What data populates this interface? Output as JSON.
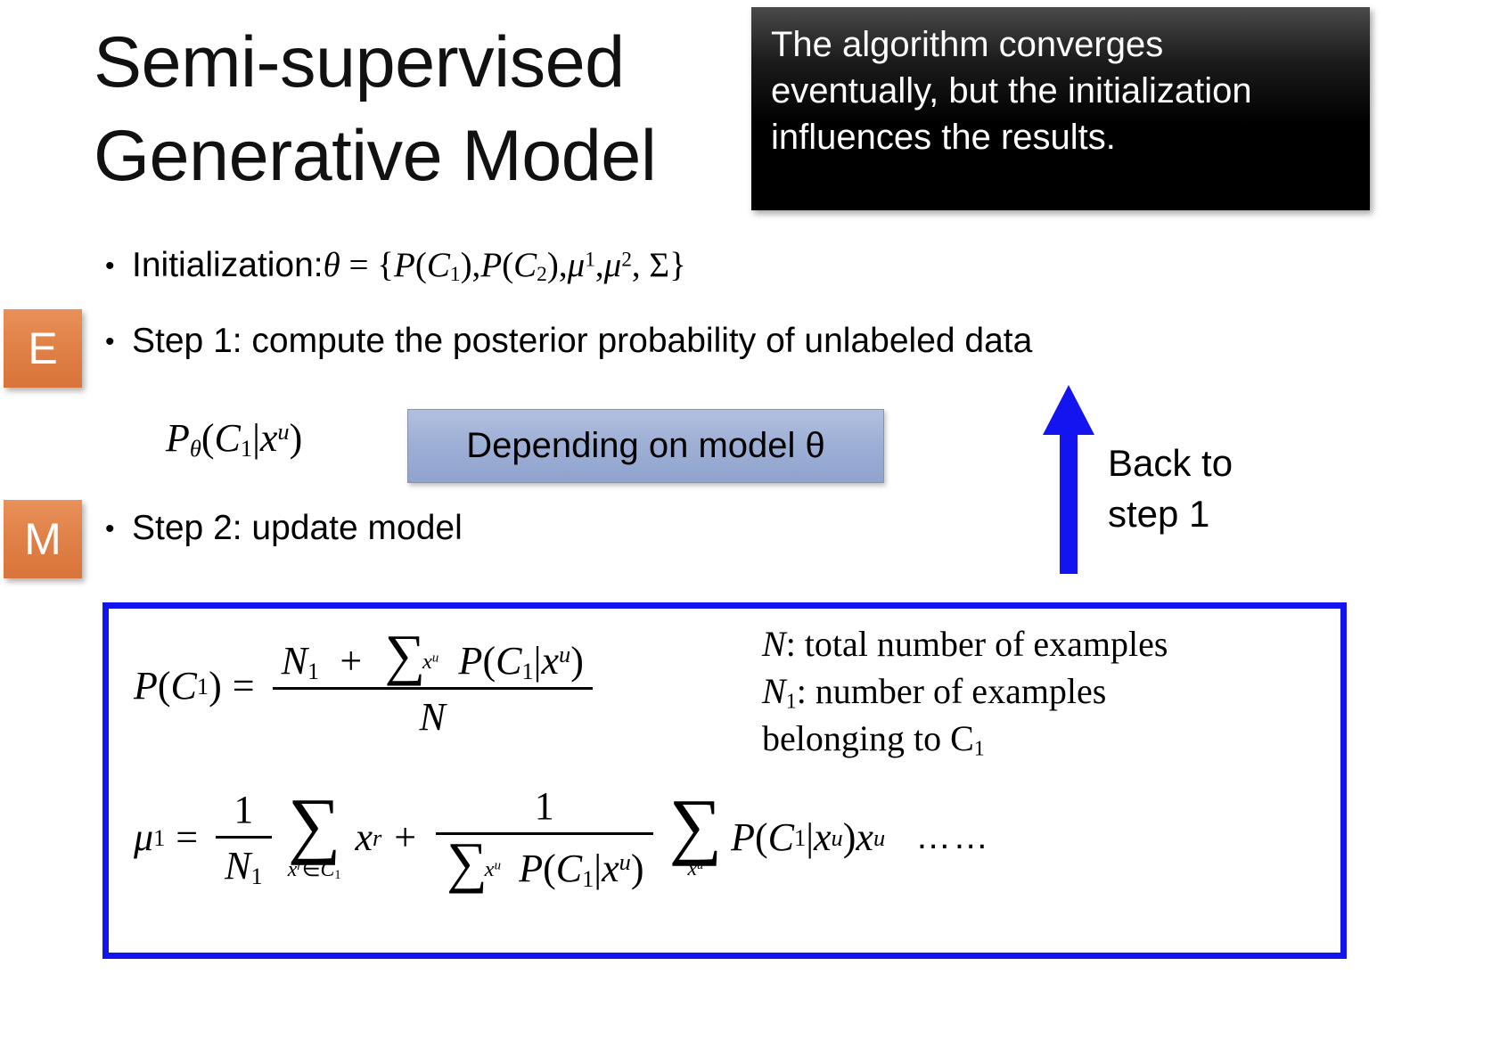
{
  "slide": {
    "title_lines": [
      "Semi-supervised",
      "Generative Model"
    ]
  },
  "callout_black": {
    "lines": [
      "The algorithm converges",
      "eventually, but the initialization",
      "influences the results."
    ],
    "background_top": "#4a4a4a",
    "background_bottom": "#000000",
    "text_color": "#ffffff"
  },
  "bullets": {
    "initialization": {
      "label": "Initialization:",
      "formula": "θ = {P(C₁),P(C₂),μ¹,μ², Σ}"
    },
    "step1": "Step 1: compute the posterior probability of unlabeled data",
    "step2": "Step 2: update model"
  },
  "badges": {
    "e": "E",
    "m": "M",
    "color": "#e08248",
    "text_color": "#ffffff"
  },
  "posterior": {
    "expression": "Pθ(C₁|xᵘ)"
  },
  "callout_blue": {
    "text": "Depending on model θ",
    "background": "#9fb0d6",
    "border": "#7f93c2"
  },
  "arrow": {
    "color": "#1414f0",
    "direction": "up"
  },
  "back_to_step": {
    "lines": [
      "Back to",
      "step 1"
    ]
  },
  "formula_box": {
    "border_color": "#1414f0",
    "equation1": {
      "lhs": "P(C₁) =",
      "numerator": "N₁ + ∑ₓᵘ P(C₁|xᵘ)",
      "denominator": "N"
    },
    "equation2": {
      "lhs": "μ¹ =",
      "term1_frac_num": "1",
      "term1_frac_den": "N₁",
      "term1_sum_limit": "xʳ∈C₁",
      "term1_body": "xʳ",
      "plus": "+",
      "term2_frac_num": "1",
      "term2_frac_den": "∑ₓᵘ P(C₁|xᵘ)",
      "term2_sum_limit": "xᵘ",
      "term2_body": "P(C₁|xᵘ)xᵘ",
      "trailing": "……"
    }
  },
  "legend": {
    "lines": [
      "N : total number of examples",
      "N₁ : number of examples",
      "belonging to C₁"
    ]
  }
}
